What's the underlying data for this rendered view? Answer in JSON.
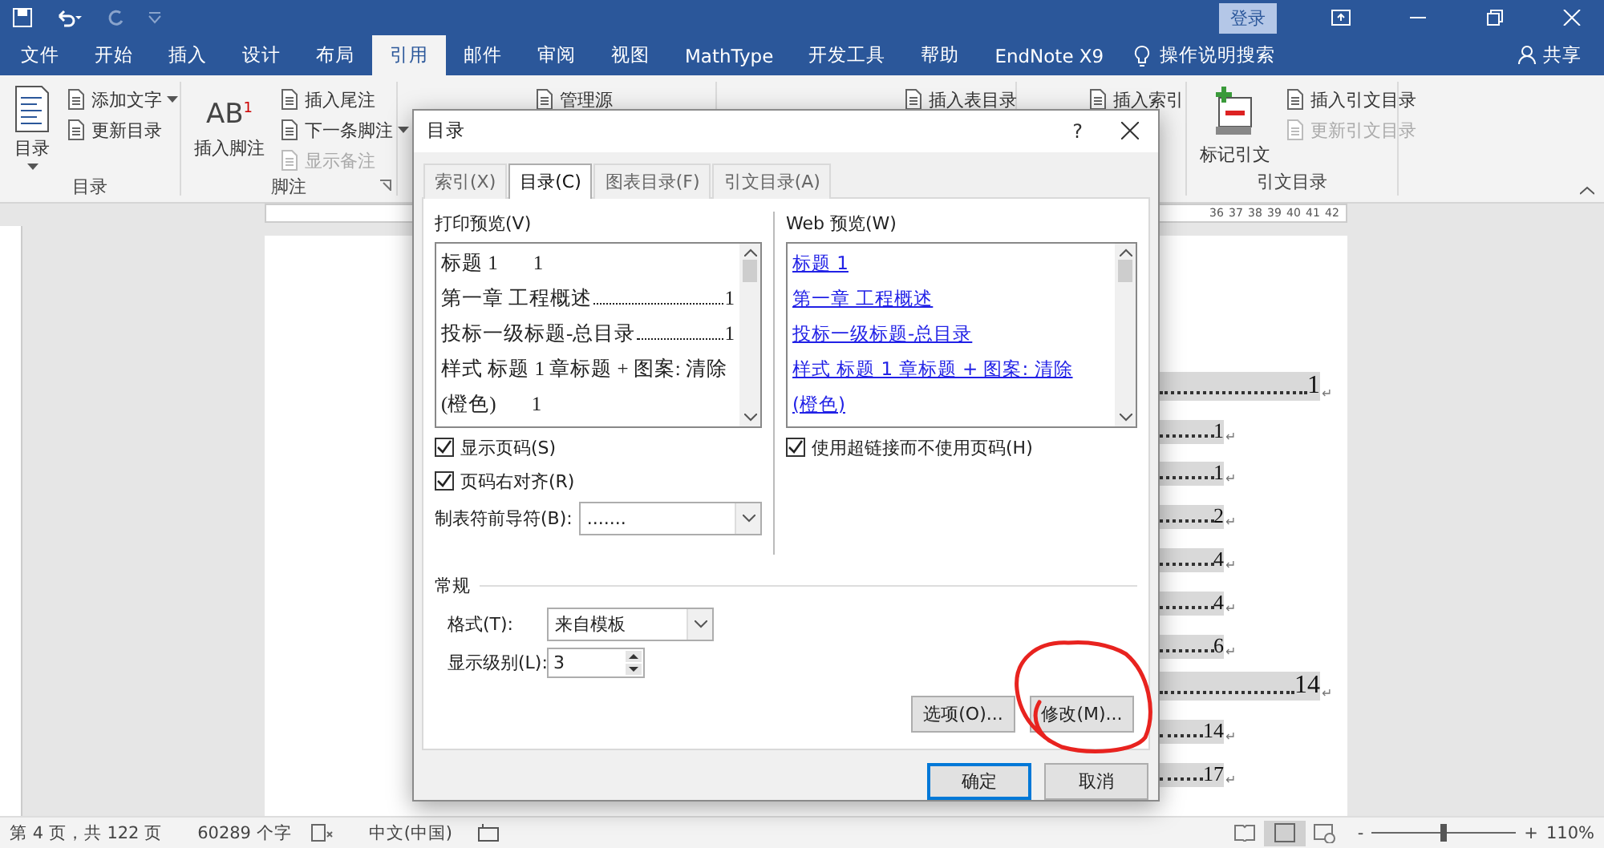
{
  "title_bar": {
    "sign_in": "登录"
  },
  "tabs": [
    {
      "label": "文件",
      "selected": false
    },
    {
      "label": "开始",
      "selected": false
    },
    {
      "label": "插入",
      "selected": false
    },
    {
      "label": "设计",
      "selected": false
    },
    {
      "label": "布局",
      "selected": false
    },
    {
      "label": "引用",
      "selected": true
    },
    {
      "label": "邮件",
      "selected": false
    },
    {
      "label": "审阅",
      "selected": false
    },
    {
      "label": "视图",
      "selected": false
    },
    {
      "label": "MathType",
      "selected": false
    },
    {
      "label": "开发工具",
      "selected": false
    },
    {
      "label": "帮助",
      "selected": false
    },
    {
      "label": "EndNote X9",
      "selected": false
    }
  ],
  "search": {
    "placeholder": "操作说明搜索"
  },
  "share": "共享",
  "ribbon": {
    "groups": [
      {
        "label": "目录",
        "items": [
          {
            "kind": "large",
            "label": "目录",
            "dropdown": true,
            "disabled": false
          },
          {
            "kind": "small",
            "label": "添加文字",
            "dropdown": true,
            "disabled": false
          },
          {
            "kind": "small",
            "label": "更新目录",
            "dropdown": false,
            "disabled": false
          }
        ]
      },
      {
        "label": "脚注",
        "items": [
          {
            "kind": "large",
            "label": "插入脚注",
            "icon_text": "AB",
            "icon_sup": "1",
            "dropdown": false,
            "disabled": false
          },
          {
            "kind": "small",
            "label": "插入尾注",
            "dropdown": false,
            "disabled": false
          },
          {
            "kind": "small",
            "label": "下一条脚注",
            "dropdown": true,
            "disabled": false
          },
          {
            "kind": "small",
            "label": "显示备注",
            "dropdown": false,
            "disabled": true
          }
        ]
      },
      {
        "items": [
          {
            "kind": "small",
            "label": "管理源",
            "dropdown": false,
            "disabled": false
          }
        ]
      },
      {
        "items": [
          {
            "kind": "small",
            "label": "插入表目录",
            "dropdown": false,
            "disabled": false
          }
        ]
      },
      {
        "items": [
          {
            "kind": "small",
            "label": "插入索引",
            "dropdown": false,
            "disabled": false
          }
        ]
      },
      {
        "label": "引文目录",
        "items": [
          {
            "kind": "large",
            "label": "标记引文",
            "dropdown": false,
            "disabled": false
          },
          {
            "kind": "small",
            "label": "插入引文目录",
            "dropdown": false,
            "disabled": false
          },
          {
            "kind": "small",
            "label": "更新引文目录",
            "dropdown": false,
            "disabled": true
          }
        ]
      }
    ]
  },
  "ruler": {
    "numbers": [
      "36",
      "37",
      "38",
      "39",
      "40",
      "41",
      "42"
    ]
  },
  "document": {
    "toc_lines": [
      {
        "kind": "chapter",
        "page": "1",
        "mark": "↵"
      },
      {
        "kind": "section",
        "page": "1",
        "mark": "↵"
      },
      {
        "kind": "section",
        "page": "1",
        "mark": "↵"
      },
      {
        "kind": "section",
        "page": "2",
        "mark": "↵"
      },
      {
        "kind": "section",
        "page": "4",
        "mark": "↵"
      },
      {
        "kind": "section",
        "page": "4",
        "mark": "↵"
      },
      {
        "kind": "section",
        "page": "6",
        "mark": "↵"
      },
      {
        "kind": "chapter",
        "page": "14",
        "mark": "↵"
      },
      {
        "kind": "section",
        "page": "14",
        "mark": "↵"
      },
      {
        "kind": "section",
        "page": "17",
        "mark": "↵"
      }
    ]
  },
  "dialog": {
    "title": "目录",
    "help": "?",
    "tabs": [
      {
        "label": "索引(X)",
        "selected": false
      },
      {
        "label": "目录(C)",
        "selected": true
      },
      {
        "label": "图表目录(F)",
        "selected": false
      },
      {
        "label": "引文目录(A)",
        "selected": false
      }
    ],
    "print_preview": {
      "label": "打印预览(V)",
      "lines": [
        {
          "text": "标题 1",
          "leader": false,
          "page": "1"
        },
        {
          "text": "第一章 工程概述",
          "leader": true,
          "page": "1"
        },
        {
          "text": "投标一级标题-总目录",
          "leader": true,
          "page": "1"
        },
        {
          "text": "样式 标题 1 章标题 + 图案: 清除 (橙色)",
          "leader": false,
          "page": "1"
        }
      ]
    },
    "web_preview": {
      "label": "Web 预览(W)",
      "links": [
        "标题 1",
        "第一章 工程概述",
        "投标一级标题-总目录",
        "样式 标题 1 章标题 + 图案: 清除 (橙色)"
      ]
    },
    "checkboxes_left": [
      {
        "label": "显示页码(S)",
        "checked": true
      },
      {
        "label": "页码右对齐(R)",
        "checked": true
      }
    ],
    "checkboxes_right": [
      {
        "label": "使用超链接而不使用页码(H)",
        "checked": true
      }
    ],
    "tab_leader": {
      "label": "制表符前导符(B):",
      "value": "......."
    },
    "general": {
      "title": "常规",
      "format": {
        "label": "格式(T):",
        "value": "来自模板"
      },
      "levels": {
        "label": "显示级别(L):",
        "value": "3"
      }
    },
    "buttons": [
      {
        "label": "选项(O)...",
        "default": false
      },
      {
        "label": "修改(M)...",
        "default": false
      }
    ],
    "footer_buttons": [
      {
        "label": "确定",
        "default": true
      },
      {
        "label": "取消",
        "default": false
      }
    ]
  },
  "status_bar": {
    "page": "第 4 页，共 122 页",
    "words": "60289 个字",
    "language": "中文(中国)",
    "zoom": {
      "minus": "-",
      "plus": "+",
      "level": 0.5,
      "reading": "110%"
    }
  }
}
